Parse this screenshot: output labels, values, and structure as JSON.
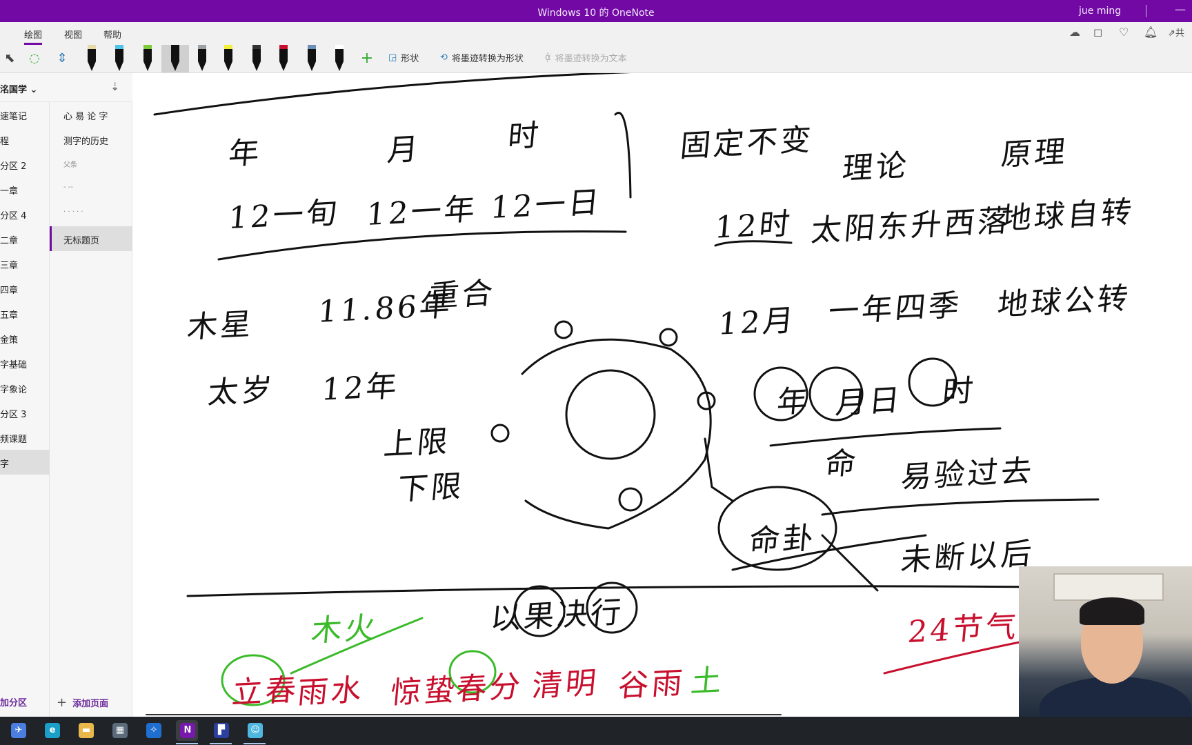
{
  "window": {
    "title": "Windows 10 的 OneNote",
    "user": "jue ming",
    "minimize": "—"
  },
  "ribbon": {
    "tabs": [
      {
        "label": "绘图",
        "active": true
      },
      {
        "label": "视图"
      },
      {
        "label": "帮助"
      }
    ],
    "tools": {
      "lasso": "lasso-select-icon",
      "eraser": "add-space-icon",
      "space": "insert-space-icon",
      "add_pen": "+"
    },
    "pens": [
      {
        "cap": "#e8d9a8",
        "body": "#c39bd3"
      },
      {
        "cap": "#4fc3e8",
        "body": "#111"
      },
      {
        "cap": "#7ccc3a",
        "body": "#111"
      },
      {
        "cap": "#111",
        "body": "#111",
        "selected": true
      },
      {
        "cap": "#9aa0a6",
        "body": "#111"
      },
      {
        "cap": "#f3ef3a",
        "body": "#111"
      },
      {
        "cap": "#333",
        "body": "#111"
      },
      {
        "cap": "#c8102e",
        "body": "#111"
      },
      {
        "cap": "#6c8fb8",
        "body": "#111"
      },
      {
        "cap": "#fff",
        "body": "#111"
      }
    ],
    "shapes_label": "形状",
    "ink_to_shape_label": "将墨迹转换为形状",
    "ink_to_text_label": "将墨迹转换为文本",
    "right_icons": [
      "sync-icon",
      "sticky-note-icon",
      "lightbulb-icon",
      "bell-icon"
    ],
    "share_label": "共"
  },
  "notebook": {
    "name": "洺国学",
    "chevron": "⌄",
    "sort_icon": "sort-icon"
  },
  "sections": [
    {
      "label": "速笔记"
    },
    {
      "label": "程"
    },
    {
      "label": "分区 2"
    },
    {
      "label": "一章"
    },
    {
      "label": "分区 4"
    },
    {
      "label": "二章"
    },
    {
      "label": "三章"
    },
    {
      "label": "四章"
    },
    {
      "label": "五章"
    },
    {
      "label": "金策"
    },
    {
      "label": "字基础"
    },
    {
      "label": "字象论"
    },
    {
      "label": "分区 3"
    },
    {
      "label": "频课题"
    },
    {
      "label": "字",
      "selected": true
    }
  ],
  "pages": [
    {
      "label": "心 易 论 字"
    },
    {
      "label": "测字的历史"
    },
    {
      "label": "父条",
      "faint": true
    },
    {
      "label": "- --",
      "faint": true
    },
    {
      "label": "· · · · ·",
      "faint": true
    },
    {
      "label": "无标题页",
      "selected": true
    }
  ],
  "add_section_label": "加分区",
  "add_page_label": "添加页面",
  "ink": {
    "black": [
      "年",
      "月",
      "时",
      "12一旬",
      "12一年",
      "12一日",
      "固定不变",
      "理论",
      "原理",
      "12时",
      "太阳东升西落",
      "地球自转",
      "木星",
      "11.86年",
      "重合",
      "太岁",
      "12年",
      "上限",
      "下限",
      "12月",
      "一年四季",
      "地球公转",
      "年",
      "月日",
      "时",
      "命",
      "命卦",
      "易验过去",
      "未断以后",
      "以果决行"
    ],
    "red": [
      "24节气",
      "立春",
      "雨水",
      "惊蛰",
      "春分",
      "清明",
      "谷雨"
    ],
    "green": [
      "木火",
      "土"
    ]
  },
  "taskbar": [
    "feishu-icon",
    "edge-icon",
    "file-explorer-icon",
    "calculator-icon",
    "app-icon",
    "onenote-icon",
    "app2-icon",
    "app3-icon"
  ]
}
